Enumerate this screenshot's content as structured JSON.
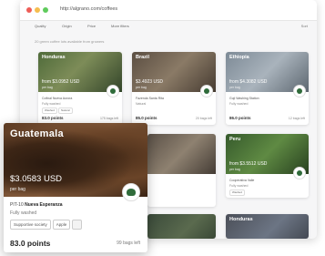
{
  "browser": {
    "url": "http://algrano.com/coffees"
  },
  "filters": {
    "labels": [
      "Quality",
      "Origin",
      "Price",
      "More filters"
    ],
    "sort": "Sort"
  },
  "results_text": "20 green coffee lots available from growers",
  "grid_cards": [
    {
      "country": "Honduras",
      "price": "from $3.0952 USD",
      "per_bag": "per bag",
      "farm": "Cofinal Nueva Aurora",
      "process": "Fully washed",
      "chips": [
        "Washed",
        "Natural"
      ],
      "points": "83.0 points",
      "bags": "175 bags left"
    },
    {
      "country": "Brazil",
      "price": "$3.4923 USD",
      "per_bag": "per bag",
      "farm": "Fazenda Santa Rita",
      "process": "Natural",
      "chips": [],
      "points": "85.0 points",
      "bags": "20 bags left"
    },
    {
      "country": "Ethiopia",
      "price": "from $4.3082 USD",
      "per_bag": "per bag",
      "farm": "Guji Washing Station",
      "process": "Fully washed",
      "chips": [],
      "points": "86.0 points",
      "bags": "12 bags left"
    },
    {
      "country": "",
      "price": "",
      "per_bag": "",
      "farm": "",
      "process": "",
      "chips": [],
      "points": "",
      "bags": ""
    },
    {
      "country": "Peru",
      "price": "from $3.5512 USD",
      "per_bag": "per bag",
      "farm": "Cooperativa Valle",
      "process": "Fully washed",
      "chips": [
        "Washed"
      ],
      "points": "84.0 points",
      "bags": "45 bags left"
    },
    {
      "country": "",
      "price": "",
      "per_bag": "",
      "farm": "",
      "process": "",
      "chips": [],
      "points": "",
      "bags": ""
    },
    {
      "country": "Honduras",
      "price": "",
      "per_bag": "",
      "farm": "",
      "process": "",
      "chips": [],
      "points": "",
      "bags": ""
    }
  ],
  "featured": {
    "country": "Guatemala",
    "price": "$3.0583 USD",
    "per_bag": "per bag",
    "farm_prefix": "PIT-10",
    "farm_name": "Nueva Esperanza",
    "process": "Fully washed",
    "chips": [
      "Supportive society",
      "Apple"
    ],
    "points": "83.0 points",
    "bags": "99 bags left"
  }
}
